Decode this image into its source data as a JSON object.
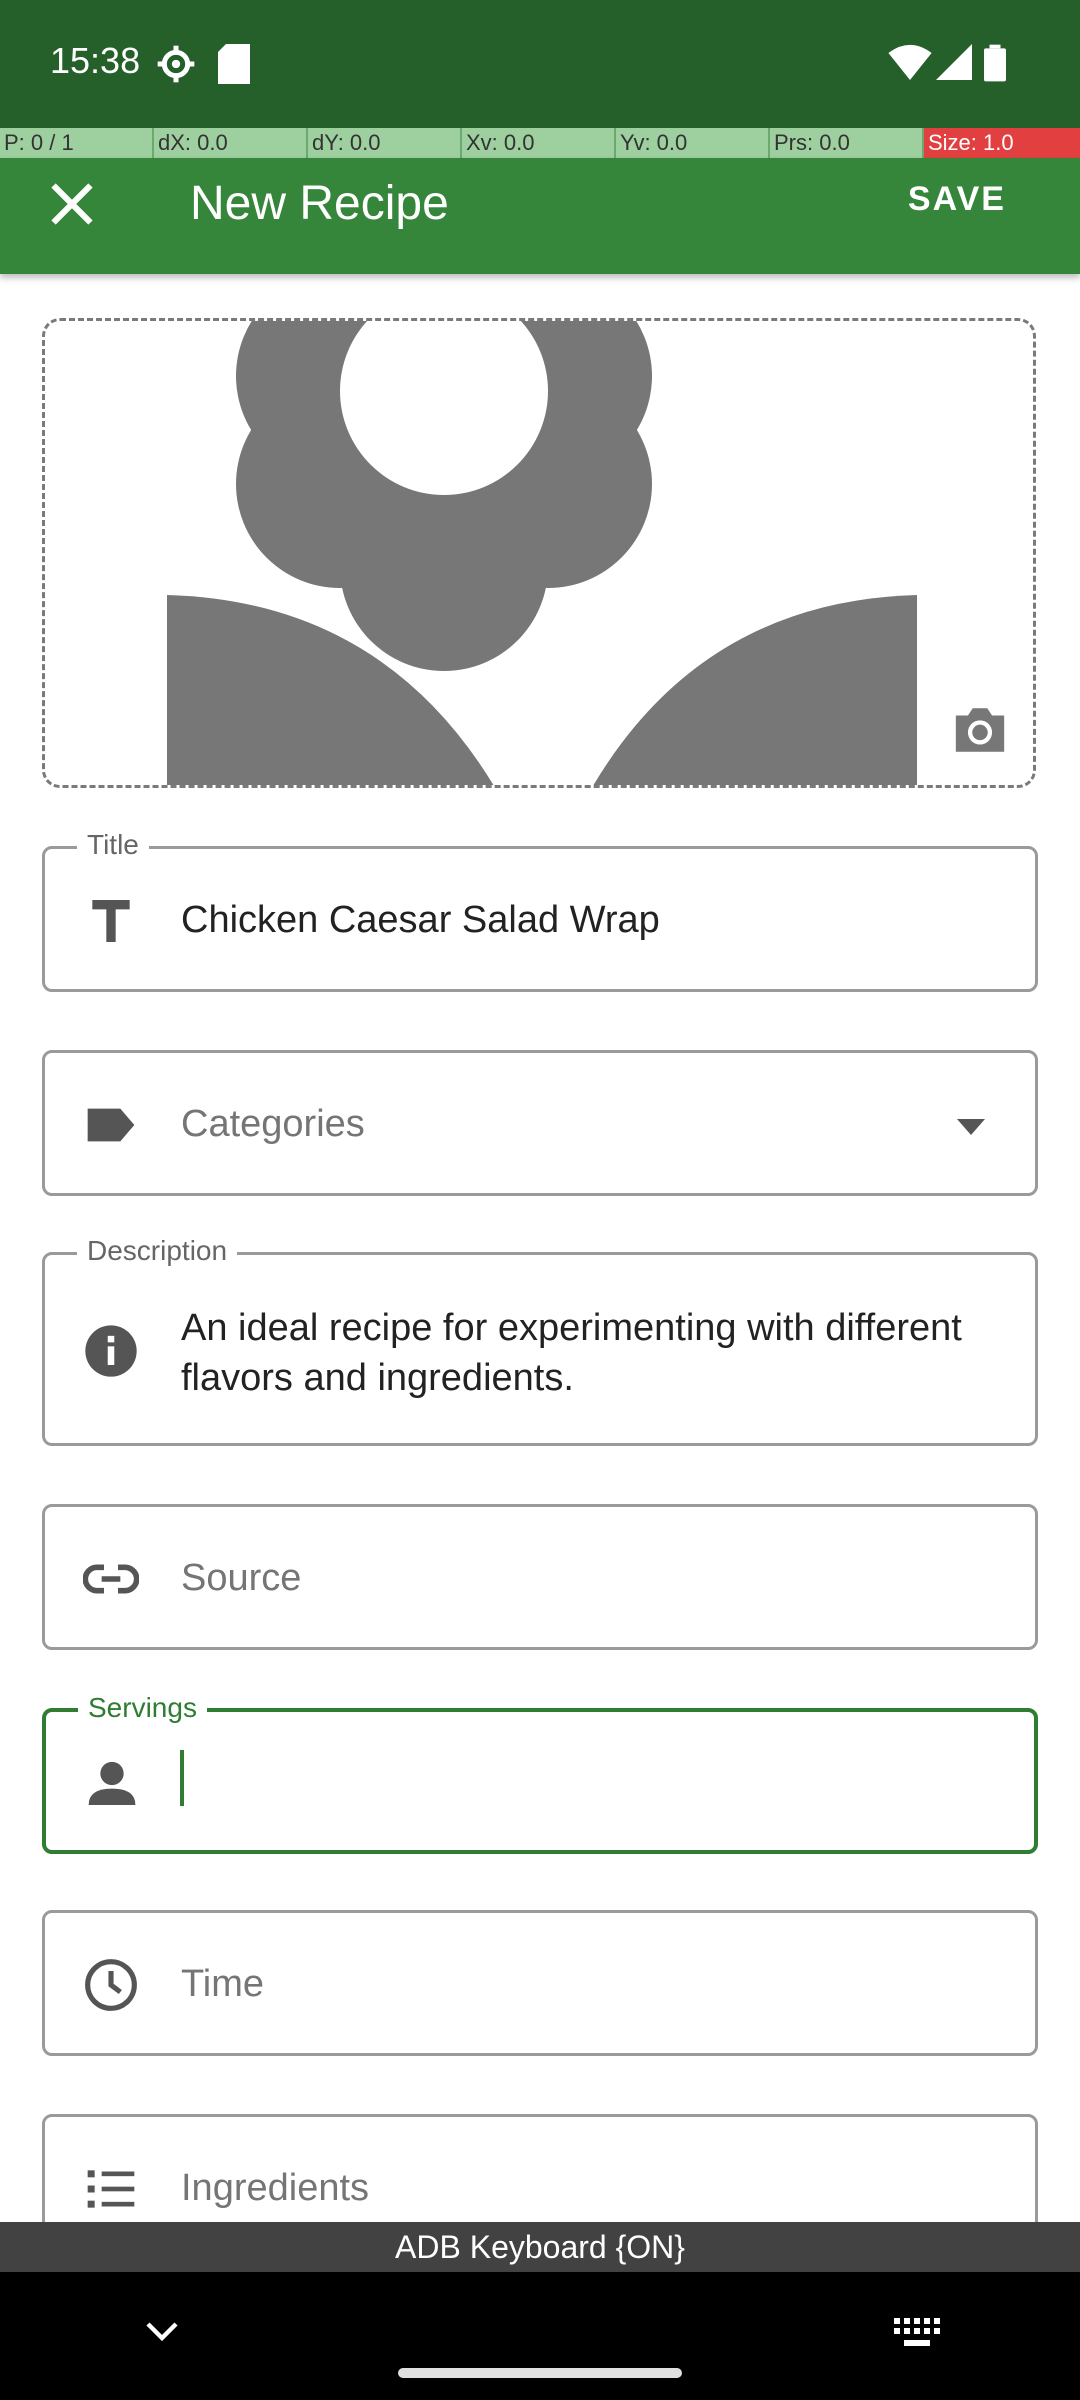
{
  "status_bar": {
    "time": "15:38"
  },
  "pointer_overlay": [
    "P: 0 / 1",
    "dX: 0.0",
    "dY: 0.0",
    "Xv: 0.0",
    "Yv: 0.0",
    "Prs: 0.0",
    "Size: 1.0"
  ],
  "app_bar": {
    "title": "New Recipe",
    "save_label": "SAVE"
  },
  "form": {
    "title": {
      "label": "Title",
      "value": "Chicken Caesar Salad Wrap"
    },
    "categories": {
      "placeholder": "Categories"
    },
    "description": {
      "label": "Description",
      "value": "An ideal recipe for experimenting with different flavors and ingredients."
    },
    "source": {
      "placeholder": "Source"
    },
    "servings": {
      "label": "Servings",
      "value": ""
    },
    "time": {
      "placeholder": "Time"
    },
    "ingredients": {
      "placeholder": "Ingredients"
    }
  },
  "keyboard_bar": {
    "label": "ADB Keyboard {ON}"
  },
  "colors": {
    "status_bar": "#25602a",
    "app_bar": "#35853a",
    "focus": "#2e7d32"
  },
  "icons": [
    "settings-icon",
    "sd-card-icon",
    "wifi-icon",
    "signal-icon",
    "battery-icon",
    "close-icon",
    "camera-icon",
    "text-icon",
    "label-icon",
    "dropdown-icon",
    "info-icon",
    "link-icon",
    "person-icon",
    "clock-icon",
    "list-icon",
    "chevron-down-icon",
    "keyboard-icon"
  ]
}
